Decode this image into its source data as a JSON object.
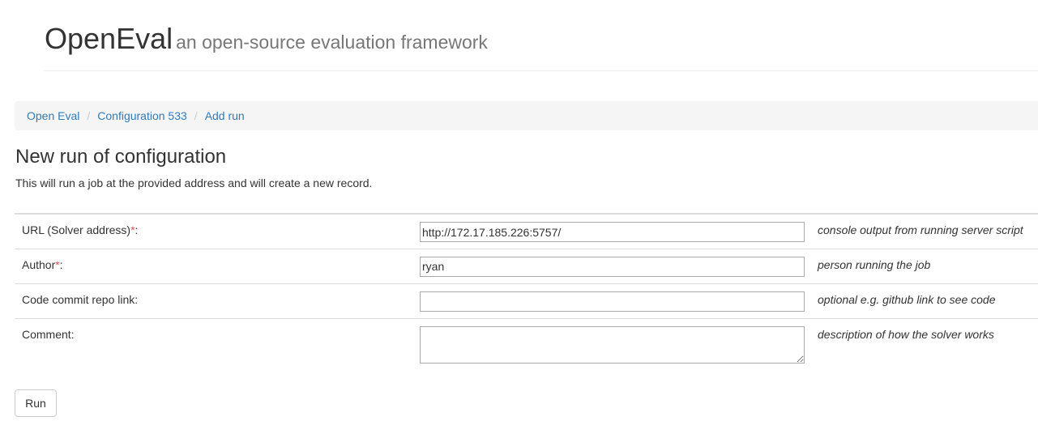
{
  "header": {
    "title": "OpenEval",
    "tagline": "an open-source evaluation framework"
  },
  "breadcrumb": {
    "items": [
      "Open Eval",
      "Configuration 533",
      "Add run"
    ],
    "separator": "/"
  },
  "main": {
    "title": "New run of configuration",
    "description": "This will run a job at the provided address and will create a new record."
  },
  "form": {
    "required_marker": "*",
    "fields": [
      {
        "label": "URL (Solver address)",
        "required": true,
        "value": "http://172.17.185.226:5757/",
        "help": "console output from running server script"
      },
      {
        "label": "Author",
        "required": true,
        "value": "ryan",
        "help": "person running the job"
      },
      {
        "label": "Code commit repo link:",
        "required": false,
        "value": "",
        "help": "optional e.g. github link to see code"
      },
      {
        "label": "Comment:",
        "required": false,
        "value": "",
        "help": "description of how the solver works"
      }
    ],
    "submit_label": "Run"
  },
  "colors": {
    "link": "#337ab7",
    "required": "#d9534f",
    "breadcrumb_bg": "#f5f5f5",
    "muted": "#777777"
  }
}
